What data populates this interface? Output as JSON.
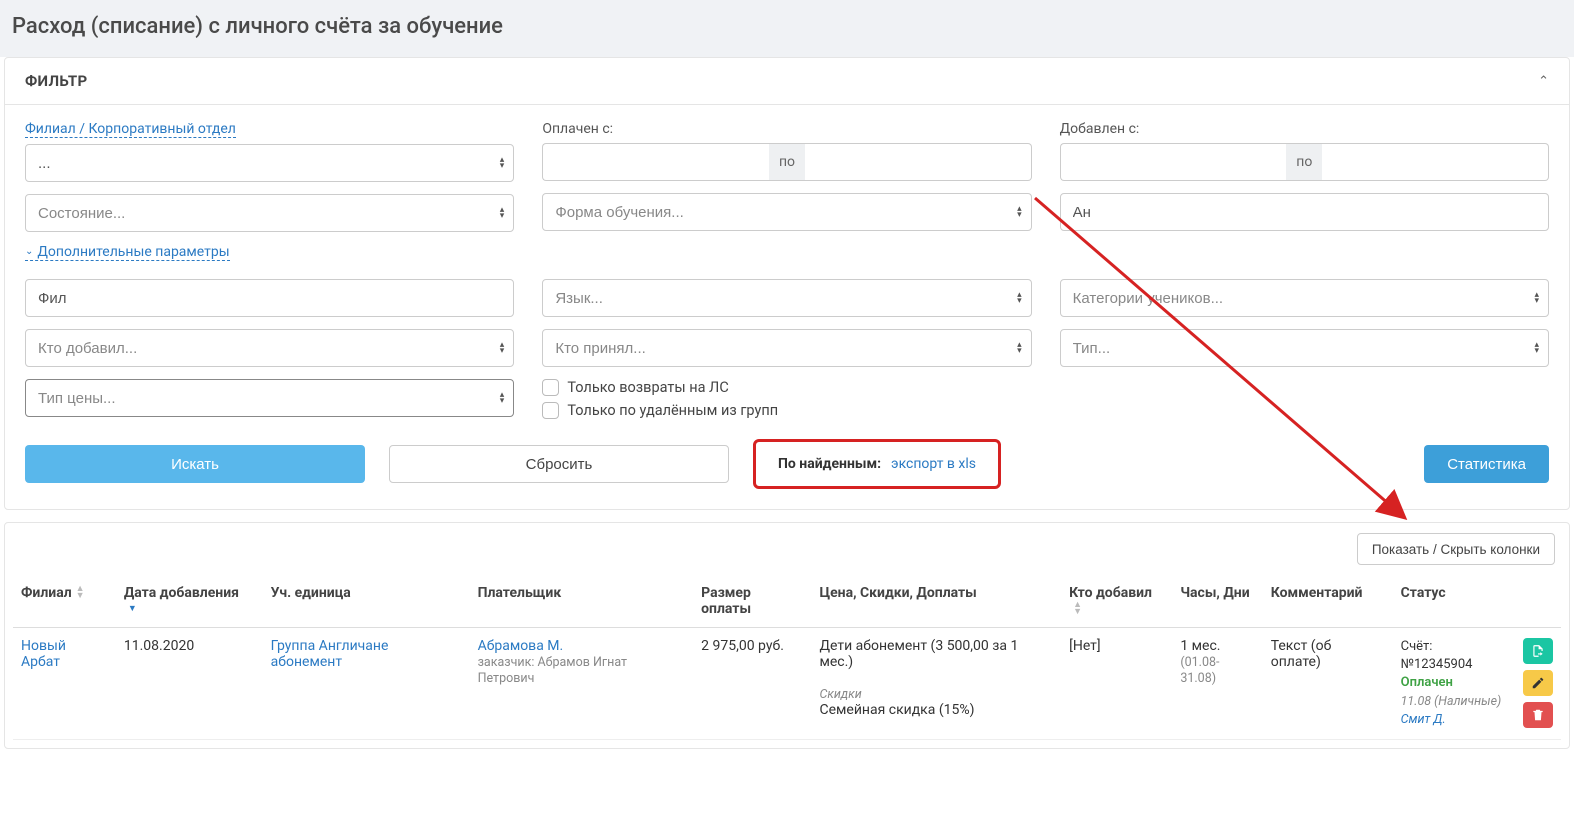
{
  "page": {
    "title": "Расход (списание) с личного счёта за обучение"
  },
  "filter": {
    "heading": "ФИЛЬТР",
    "labels": {
      "branch": "Филиал / Корпоративный отдел",
      "paid_from": "Оплачен с:",
      "added_from": "Добавлен с:",
      "extra_params": "Дополнительные параметры",
      "to_sep": "по"
    },
    "branch_value": "...",
    "state_placeholder": "Состояние...",
    "edu_form_placeholder": "Форма обучения...",
    "search_an_value": "Ан",
    "fil_value": "Фил",
    "language_placeholder": "Язык...",
    "categories_placeholder": "Категории учеников...",
    "who_added_placeholder": "Кто добавил...",
    "who_accepted_placeholder": "Кто принял...",
    "type_placeholder": "Тип...",
    "price_type_placeholder": "Тип цены...",
    "cb_returns": "Только возвраты на ЛС",
    "cb_deleted": "Только по удалённым из групп",
    "btn_search": "Искать",
    "btn_reset": "Сбросить",
    "export_label": "По найденным:",
    "export_link": "экспорт в xls",
    "btn_stats": "Статистика"
  },
  "results": {
    "columns_btn": "Показать / Скрыть колонки",
    "headers": {
      "branch": "Филиал",
      "date_added": "Дата добавления",
      "unit": "Уч. единица",
      "payer": "Плательщик",
      "amount": "Размер оплаты",
      "price": "Цена, Скидки, Доплаты",
      "who_added": "Кто добавил",
      "hours": "Часы, Дни",
      "comment": "Комментарий",
      "status": "Статус"
    },
    "rows": [
      {
        "branch": "Новый Арбат",
        "date_added": "11.08.2020",
        "unit": "Группа Англичане абонемент",
        "payer": "Абрамова М.",
        "payer_sub": "заказчик: Абрамов Игнат Петрович",
        "amount": "2 975,00 руб.",
        "price_main": "Дети абонемент (3 500,00 за 1 мес.)",
        "price_discount_label": "Скидки",
        "price_discount": "Семейная скидка (15%)",
        "who_added": "[Нет]",
        "hours": "1 мес.",
        "hours_sub": "(01.08-31.08)",
        "comment": "Текст (об оплате)",
        "status_account": "Счёт: №12345904",
        "status_paid": "Оплачен",
        "status_date": "11.08 (Наличные)",
        "status_person": "Смит Д."
      }
    ]
  }
}
